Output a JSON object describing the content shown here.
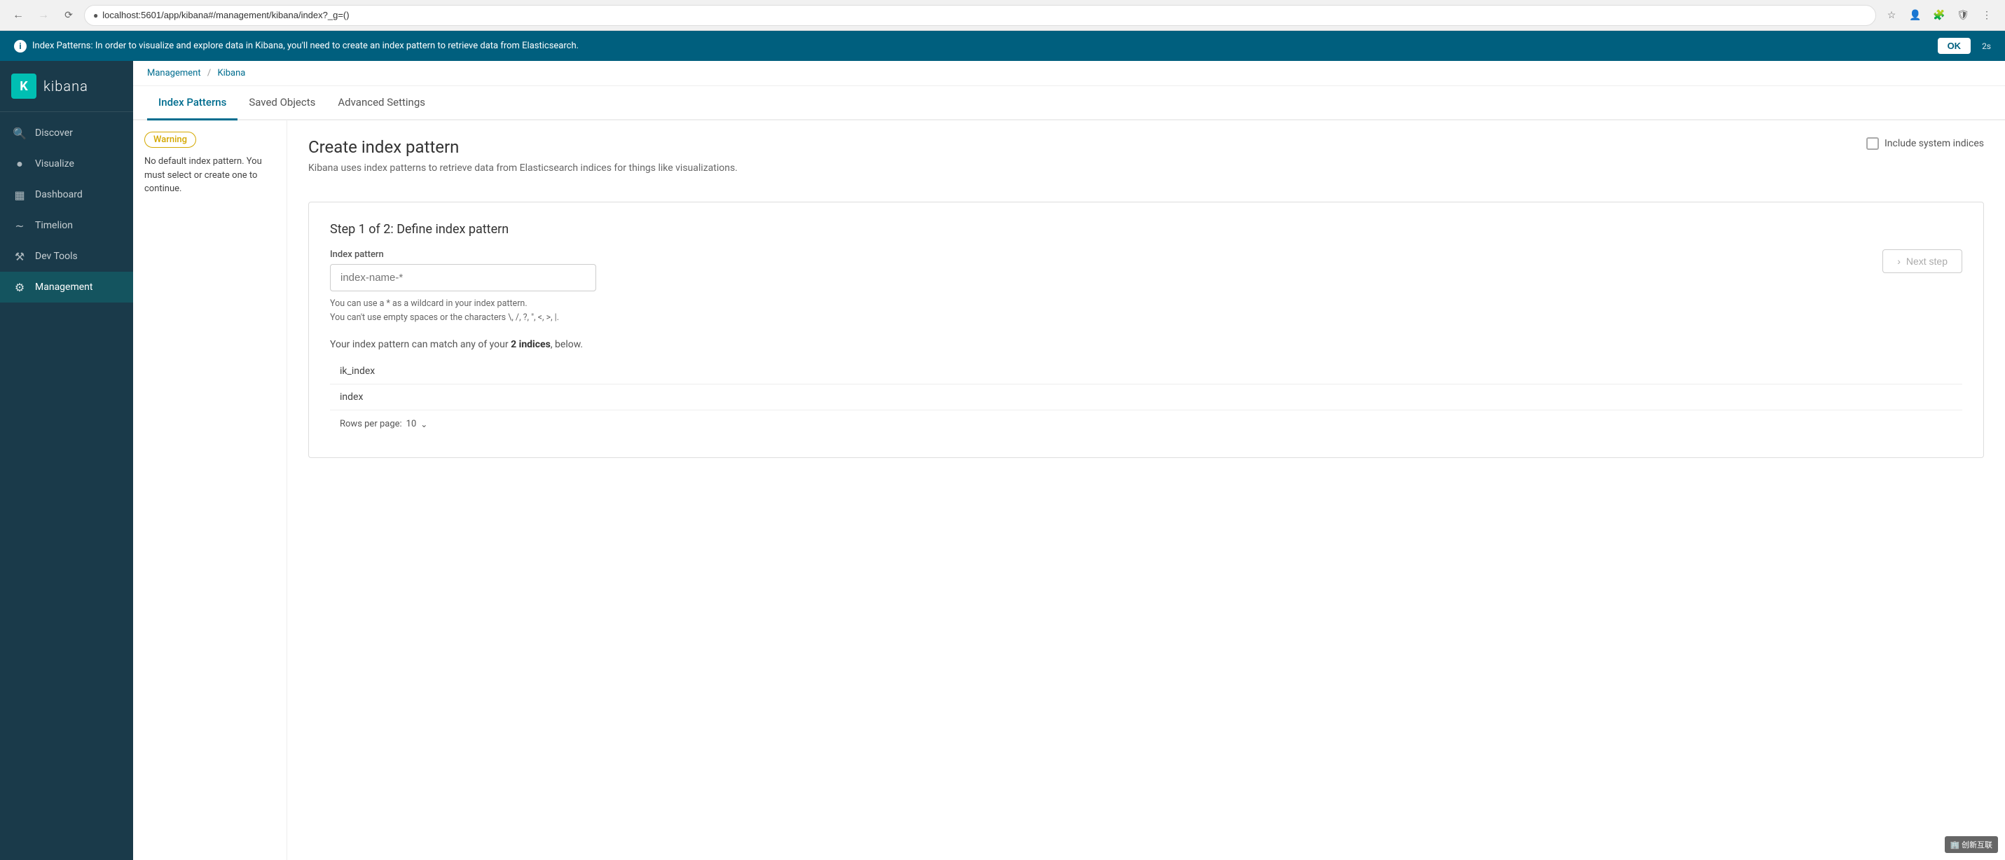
{
  "browser": {
    "url": "localhost:5601/app/kibana#/management/kibana/index?_g=()",
    "back_disabled": false,
    "forward_disabled": true
  },
  "banner": {
    "message": "Index Patterns: In order to visualize and explore data in Kibana, you'll need to create an index pattern to retrieve data from Elasticsearch.",
    "ok_label": "OK",
    "timer": "2s"
  },
  "sidebar": {
    "logo_letter": "K",
    "app_name": "kibana",
    "items": [
      {
        "id": "discover",
        "label": "Discover",
        "icon": "🔍"
      },
      {
        "id": "visualize",
        "label": "Visualize",
        "icon": "📊"
      },
      {
        "id": "dashboard",
        "label": "Dashboard",
        "icon": "⊞"
      },
      {
        "id": "timelion",
        "label": "Timelion",
        "icon": "〜"
      },
      {
        "id": "devtools",
        "label": "Dev Tools",
        "icon": "⚙"
      },
      {
        "id": "management",
        "label": "Management",
        "icon": "⚙",
        "active": true
      }
    ]
  },
  "breadcrumb": {
    "items": [
      {
        "label": "Management",
        "href": "#"
      },
      {
        "label": "Kibana",
        "href": "#"
      }
    ]
  },
  "tabs": [
    {
      "id": "index-patterns",
      "label": "Index Patterns",
      "active": true
    },
    {
      "id": "saved-objects",
      "label": "Saved Objects",
      "active": false
    },
    {
      "id": "advanced-settings",
      "label": "Advanced Settings",
      "active": false
    }
  ],
  "warning": {
    "badge_label": "Warning",
    "message": "No default index pattern. You must select or create one to continue."
  },
  "page": {
    "title": "Create index pattern",
    "subtitle": "Kibana uses index patterns to retrieve data from Elasticsearch indices for things like visualizations.",
    "include_system_label": "Include system indices"
  },
  "step": {
    "title": "Step 1 of 2: Define index pattern",
    "field_label": "Index pattern",
    "placeholder": "index-name-*",
    "hint_line1": "You can use a * as a wildcard in your index pattern.",
    "hint_line2": "You can't use empty spaces or the characters \\, /, ?, \", <, >, |.",
    "matches_prefix": "Your index pattern can match any of your ",
    "matches_count": "2 indices",
    "matches_suffix": ", below.",
    "next_btn_label": "Next step",
    "indices": [
      {
        "name": "ik_index"
      },
      {
        "name": "index"
      }
    ],
    "rows_per_page_label": "Rows per page:",
    "rows_per_page_value": "10"
  },
  "watermark": "🏢 创新互联"
}
